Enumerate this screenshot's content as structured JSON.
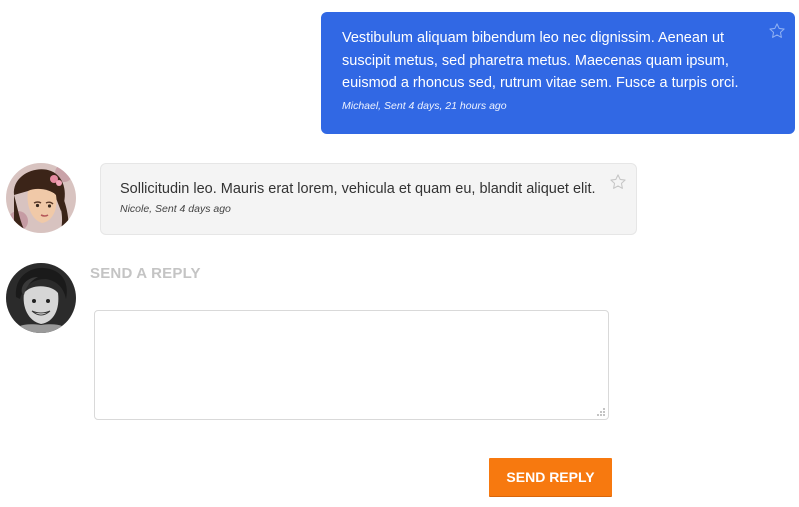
{
  "messages": [
    {
      "direction": "outgoing",
      "text": "Vestibulum aliquam bibendum leo nec dignissim. Aenean ut suscipit metus, sed pharetra metus. Maecenas quam ipsum, euismod a rhoncus sed, rutrum vitae sem. Fusce a turpis orci.",
      "meta": "Michael, Sent 4 days, 21 hours ago",
      "starred": false,
      "bubble_color": "#3168e4"
    },
    {
      "direction": "incoming",
      "text": "Sollicitudin leo. Mauris erat lorem, vehicula et quam eu, blandit aliquet elit.",
      "meta": "Nicole, Sent 4 days ago",
      "starred": false,
      "bubble_color": "#f4f4f4"
    }
  ],
  "reply": {
    "heading": "SEND A REPLY",
    "value": "",
    "button_label": "SEND REPLY",
    "button_color": "#f7790f"
  },
  "icons": {
    "star": "star-outline-icon",
    "resize": "resize-grip-icon"
  }
}
